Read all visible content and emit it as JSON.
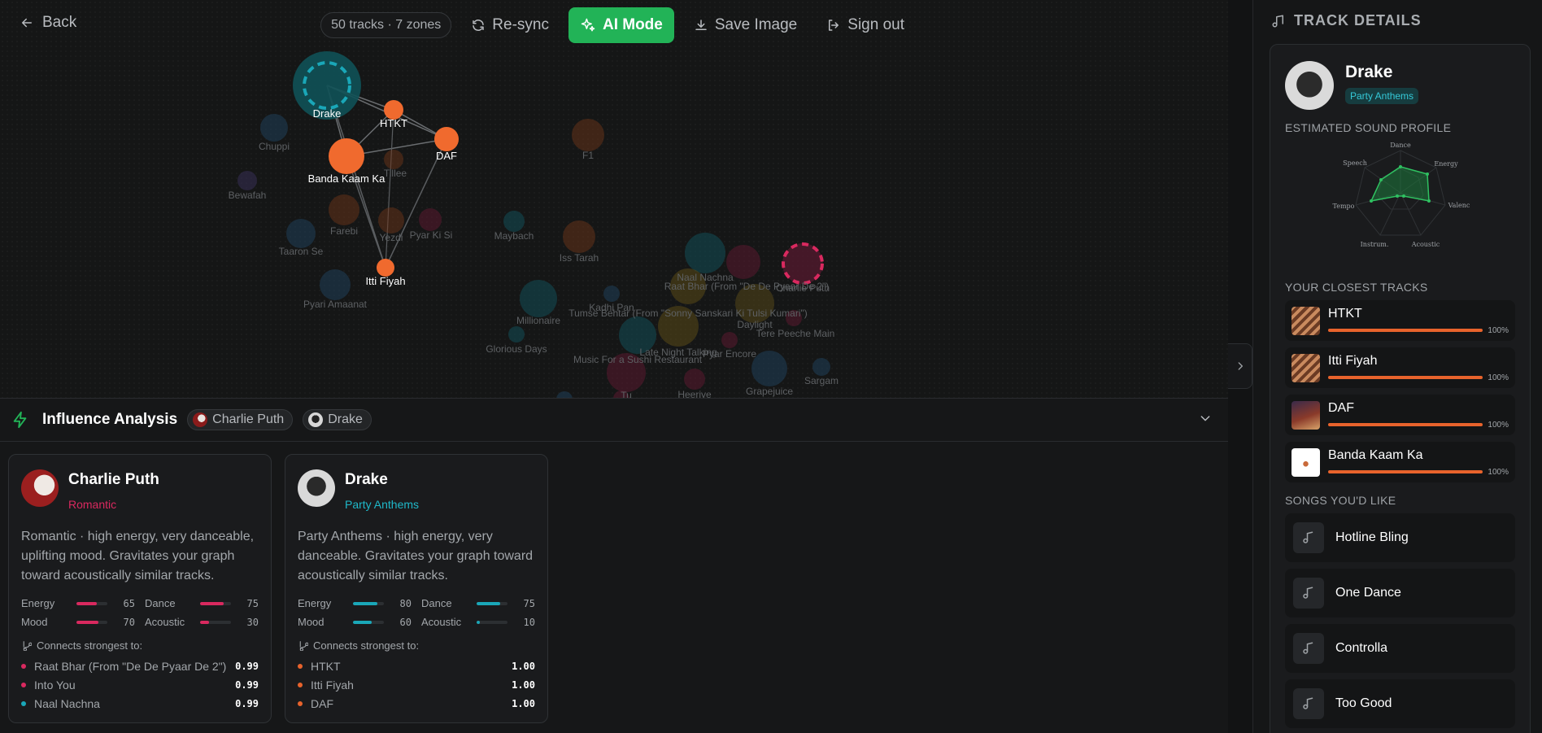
{
  "header": {
    "back_label": "Back",
    "status_pill": "50 tracks · 7 zones",
    "resync_label": "Re-sync",
    "ai_mode_label": "AI Mode",
    "save_image_label": "Save Image",
    "sign_out_label": "Sign out"
  },
  "colors": {
    "accent_green": "#22b357",
    "orange": "#e8632c",
    "teal": "#1aa7b8",
    "pink": "#d9295f"
  },
  "graph": {
    "highlighted_nodes": [
      "Drake",
      "HTKT",
      "DAF",
      "Banda Kaam Ka",
      "Itti Fiyah"
    ],
    "labels": [
      "Drake",
      "HTKT",
      "DAF",
      "Banda Kaam Ka",
      "Itti Fiyah",
      "Chuppi",
      "Tillee",
      "Bewafah",
      "Farebi",
      "Yezdi",
      "Pyar Ki Si",
      "Taaron Se",
      "Pyari Amaanat",
      "F1",
      "Maybach",
      "Iss Tarah",
      "Naal Nachna",
      "Raat Bhar (From \"De De Pyaar De 2\")",
      "Charlie Puth",
      "Kadhi Pan",
      "Millionaire",
      "Tumse Behtar (From \"Sonny Sanskari Ki Tulsi Kumari\")",
      "Daylight",
      "Tere Peeche Main",
      "Glorious Days",
      "Late Night Talking",
      "Pyar Encore",
      "Music For a Sushi Restaurant",
      "Grapejuice",
      "Sargam",
      "Heeriye",
      "Tu"
    ]
  },
  "influence": {
    "title": "Influence Analysis",
    "chips": [
      "Charlie Puth",
      "Drake"
    ],
    "cards": [
      {
        "name": "Charlie Puth",
        "tag": "Romantic",
        "desc": "Romantic · high energy, very danceable, uplifting mood. Gravitates your graph toward acoustically similar tracks.",
        "stats": {
          "energy_label": "Energy",
          "energy": "65",
          "dance_label": "Dance",
          "dance": "75",
          "mood_label": "Mood",
          "mood": "70",
          "acoustic_label": "Acoustic",
          "acoustic": "30"
        },
        "connects_title": "Connects strongest to:",
        "connections": [
          {
            "name": "Raat Bhar (From \"De De Pyaar De 2\")",
            "value": "0.99"
          },
          {
            "name": "Into You",
            "value": "0.99"
          },
          {
            "name": "Naal Nachna",
            "value": "0.99"
          }
        ]
      },
      {
        "name": "Drake",
        "tag": "Party Anthems",
        "desc": "Party Anthems · high energy, very danceable. Gravitates your graph toward acoustically similar tracks.",
        "stats": {
          "energy_label": "Energy",
          "energy": "80",
          "dance_label": "Dance",
          "dance": "75",
          "mood_label": "Mood",
          "mood": "60",
          "acoustic_label": "Acoustic",
          "acoustic": "10"
        },
        "connects_title": "Connects strongest to:",
        "connections": [
          {
            "name": "HTKT",
            "value": "1.00"
          },
          {
            "name": "Itti Fiyah",
            "value": "1.00"
          },
          {
            "name": "DAF",
            "value": "1.00"
          }
        ]
      }
    ]
  },
  "sidebar": {
    "title": "TRACK DETAILS",
    "artist": "Drake",
    "artist_tag": "Party Anthems",
    "sound_profile_title": "ESTIMATED SOUND PROFILE",
    "radar_axes": [
      "Dance",
      "Energy",
      "Valenc",
      "Acoustic",
      "Instrum.",
      "Tempo",
      "Speech"
    ],
    "closest_title": "YOUR CLOSEST TRACKS",
    "closest_tracks": [
      {
        "name": "HTKT",
        "pct": "100%"
      },
      {
        "name": "Itti Fiyah",
        "pct": "100%"
      },
      {
        "name": "DAF",
        "pct": "100%"
      },
      {
        "name": "Banda Kaam Ka",
        "pct": "100%"
      }
    ],
    "songs_title": "SONGS YOU'D LIKE",
    "songs": [
      "Hotline Bling",
      "One Dance",
      "Controlla",
      "Too Good"
    ]
  }
}
